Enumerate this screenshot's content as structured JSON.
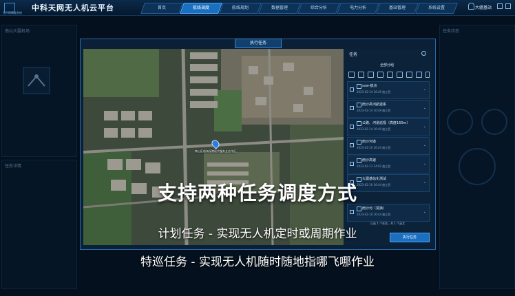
{
  "header": {
    "logo_lines": [
      "Q",
      "无人机调度系统"
    ],
    "app_title": "中科天网无人机云平台",
    "nav": [
      "首页",
      "航线调度",
      "航线规划",
      "数据管理",
      "综合分析",
      "电力分析",
      "基站管理",
      "系统设置"
    ],
    "active_nav_index": 1,
    "username": "大疆基站"
  },
  "left_panel": {
    "title": "南山大疆机场",
    "subtitle": "任务详情"
  },
  "right_panel": {
    "title": "任务状态"
  },
  "dialog": {
    "title": "执行任务",
    "map_marker_label": "南山区前海深港现代服务业合作区"
  },
  "task_panel": {
    "title": "任务",
    "filter": "全部分组",
    "tasks": [
      {
        "name": "sxw-航点",
        "date": "2023-02-14 16:49 曲江西"
      },
      {
        "name": "南沙高河航迹系",
        "date": "2023-02-14 16:49 曲江西"
      },
      {
        "name": "公路、河道巡视（高度160m）",
        "date": "2023-02-14 16:49 曲江西"
      },
      {
        "name": "南沙河道",
        "date": "2023-02-10 16:44 曲江西"
      },
      {
        "name": "南沙高速",
        "date": "2023-02-13 14:02 曲江西"
      },
      {
        "name": "大疆基站化测试",
        "date": "2023-02-10 16:44 曲江西"
      },
      {
        "name": "南沙河（变换）",
        "date": "2023-02-10 16:44 曲江西"
      }
    ],
    "footer": "已选 1 个任务，共 1 个英文",
    "execute_button": "执行任务"
  },
  "overlay": {
    "headline": "支持两种任务调度方式",
    "line1": "计划任务 - 实现无人机定时或周期作业",
    "line2": "特巡任务 - 实现无人机随时随地指哪飞哪作业"
  }
}
